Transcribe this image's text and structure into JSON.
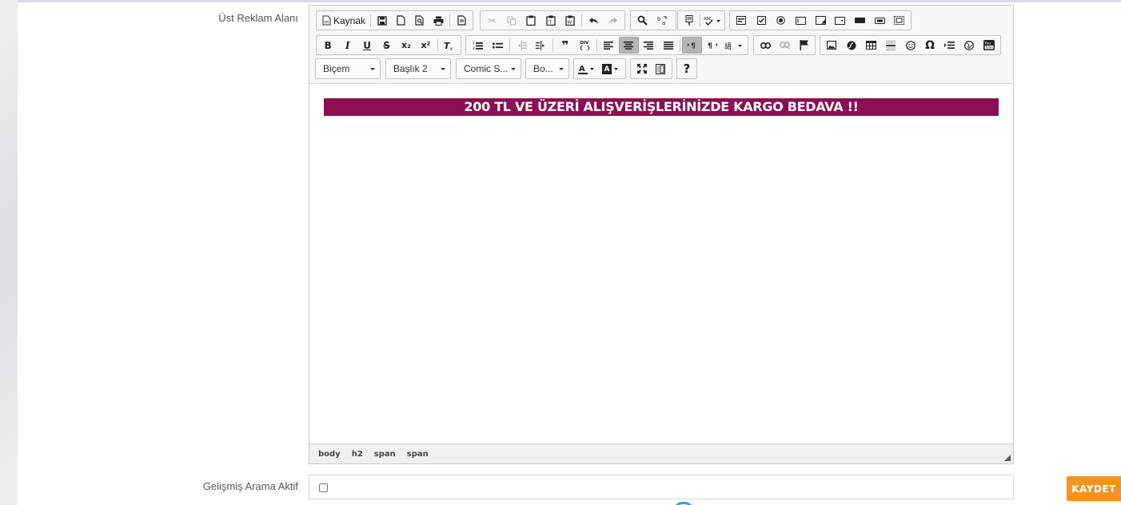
{
  "labels": {
    "ust_reklam": "Üst Reklam Alanı",
    "gelismis_arama": "Gelişmiş Arama Aktif"
  },
  "toolbar": {
    "source_label": "Kaynak",
    "bold": "B",
    "italic": "I",
    "underline": "U",
    "strike": "S",
    "subscript": "x₂",
    "superscript": "x²",
    "quote": "❞",
    "special_char": "Ω",
    "help": "?",
    "format_combo": "Biçem",
    "heading_combo": "Başlık 2",
    "font_combo": "Comic S...",
    "size_combo": "Bo..."
  },
  "content": {
    "banner_text": "200 TL VE ÜZERİ ALIŞVERİŞLERİNİZDE KARGO BEDAVA !!",
    "banner_bg": "#8b0f51"
  },
  "path": [
    "body",
    "h2",
    "span",
    "span"
  ],
  "save_button": "KAYDET",
  "colors": {
    "accent": "#f6921e",
    "spinner": "#2d9ee0"
  }
}
